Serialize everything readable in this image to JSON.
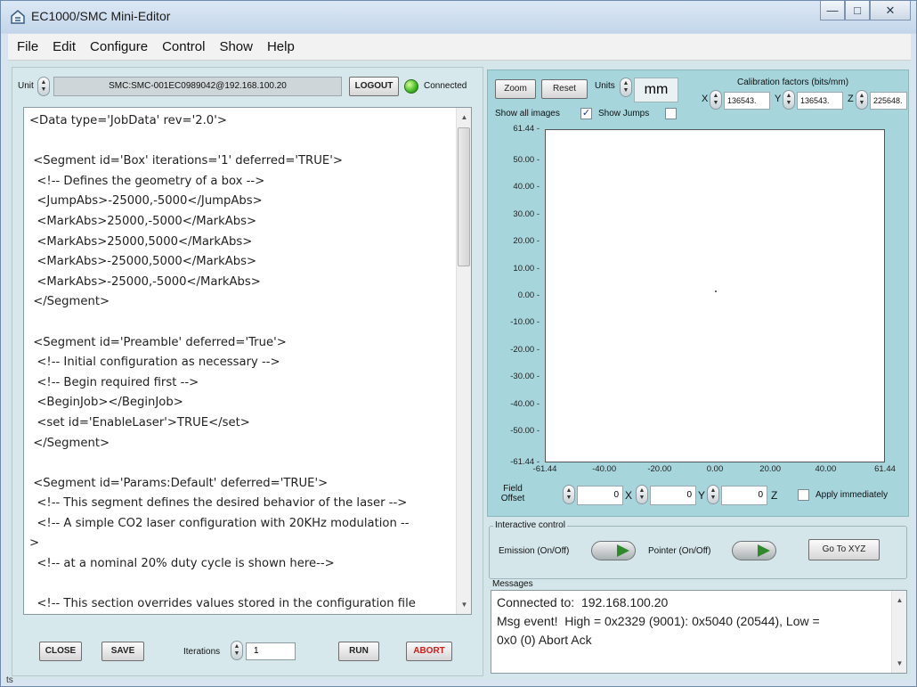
{
  "window": {
    "title": "EC1000/SMC Mini-Editor"
  },
  "menu": [
    "File",
    "Edit",
    "Configure",
    "Control",
    "Show",
    "Help"
  ],
  "unit": {
    "label": "Unit",
    "value": "SMC:SMC-001EC0989042@192.168.100.20",
    "logout_label": "LOGOUT",
    "status_text": "Connected"
  },
  "editor": {
    "lines": [
      "<Data type='JobData' rev='2.0'>",
      "",
      " <Segment id='Box' iterations='1' deferred='TRUE'>",
      "  <!-- Defines the geometry of a box -->",
      "  <JumpAbs>-25000,-5000</JumpAbs>",
      "  <MarkAbs>25000,-5000</MarkAbs>",
      "  <MarkAbs>25000,5000</MarkAbs>",
      "  <MarkAbs>-25000,5000</MarkAbs>",
      "  <MarkAbs>-25000,-5000</MarkAbs>",
      " </Segment>",
      "",
      " <Segment id='Preamble' deferred='True'>",
      "  <!-- Initial configuration as necessary -->",
      "  <!-- Begin required first -->",
      "  <BeginJob></BeginJob>",
      "  <set id='EnableLaser'>TRUE</set>",
      " </Segment>",
      "",
      " <Segment id='Params:Default' deferred='TRUE'>",
      "  <!-- This segment defines the desired behavior of the laser -->",
      "  <!-- A simple CO2 laser configuration with 20KHz modulation --",
      ">",
      "  <!-- at a nominal 20% duty cycle is shown here-->",
      "",
      "  <!-- This section overrides values stored in the configuration file",
      "-->"
    ]
  },
  "bottom": {
    "close_label": "CLOSE",
    "save_label": "SAVE",
    "iterations_label": "Iterations",
    "iterations_value": "1",
    "run_label": "RUN",
    "abort_label": "ABORT"
  },
  "view": {
    "zoom_label": "Zoom",
    "reset_label": "Reset",
    "units_label": "Units",
    "units_value": "mm",
    "show_all_images_label": "Show all images",
    "show_all_images_checked": true,
    "show_jumps_label": "Show Jumps",
    "show_jumps_checked": false,
    "calibration_title": "Calibration factors  (bits/mm)",
    "calib_x": "136543.",
    "calib_y": "136543.",
    "calib_z": "225648.",
    "x_letter": "X",
    "y_letter": "Y",
    "z_letter": "Z"
  },
  "plot": {
    "y_ticks": [
      "61.44",
      "50.00",
      "40.00",
      "30.00",
      "20.00",
      "10.00",
      "0.00",
      "-10.00",
      "-20.00",
      "-30.00",
      "-40.00",
      "-50.00",
      "-61.44"
    ],
    "x_ticks": [
      "-61.44",
      "-40.00",
      "-20.00",
      "0.00",
      "20.00",
      "40.00",
      "61.44"
    ]
  },
  "offset": {
    "label_line1": "Field",
    "label_line2": "Offset",
    "x_value": "0",
    "y_value": "0",
    "z_value": "0",
    "apply_label": "Apply immediately",
    "apply_checked": false
  },
  "interactive": {
    "title": "Interactive control",
    "emission_label": "Emission (On/Off)",
    "pointer_label": "Pointer (On/Off)",
    "goto_label": "Go To XYZ"
  },
  "messages": {
    "title": "Messages",
    "text": "Connected to:  192.168.100.20\nMsg event!  High = 0x2329 (9001): 0x5040 (20544), Low =\n0x0 (0) Abort Ack"
  },
  "side_fragment": "ts",
  "colors": {
    "panel_bg": "#d4e6ea",
    "plot_frame": "#a6d5dc",
    "led_green": "#3fb81f",
    "abort_red": "#d01b1b"
  }
}
